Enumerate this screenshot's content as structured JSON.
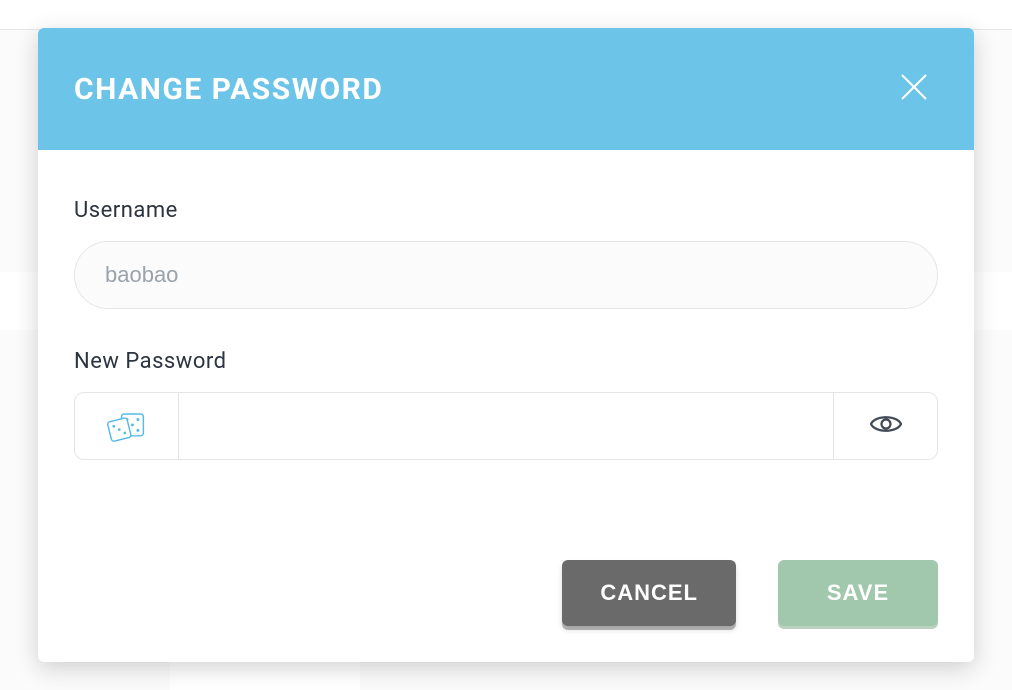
{
  "modal": {
    "title": "CHANGE PASSWORD",
    "fields": {
      "username": {
        "label": "Username",
        "value": "baobao"
      },
      "new_password": {
        "label": "New Password",
        "value": ""
      }
    },
    "buttons": {
      "cancel": "CANCEL",
      "save": "SAVE"
    }
  }
}
